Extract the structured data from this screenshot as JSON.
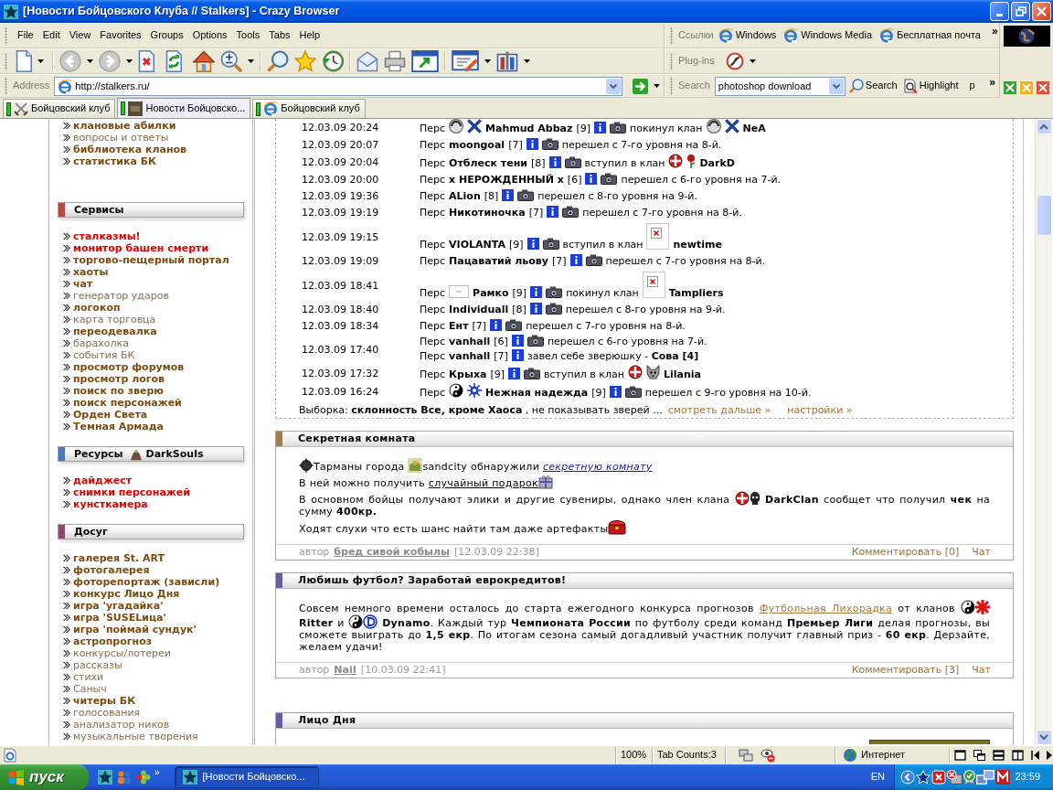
{
  "window": {
    "title": "[Новости Бойцовского Клуба // Stalkers] - Crazy Browser"
  },
  "menu": [
    "File",
    "Edit",
    "View",
    "Favorites",
    "Groups",
    "Options",
    "Tools",
    "Tabs",
    "Help"
  ],
  "links_bar": {
    "label": "Ссылки",
    "links": [
      "Windows",
      "Windows Media",
      "Бесплатная почта"
    ],
    "more": "»"
  },
  "toolbar": {
    "back": {
      "disabled": true
    },
    "forward": {
      "disabled": true
    }
  },
  "plugins_bar": {
    "label": "Plug-ins"
  },
  "address_bar": {
    "label": "Address",
    "value": "http://stalkers.ru/"
  },
  "search_bar": {
    "label": "Search",
    "value": "photoshop download",
    "buttons": [
      "Search",
      "Highlight"
    ],
    "overflow": "p",
    "more": "»"
  },
  "tabs": [
    {
      "label": "Бойцовский клуб",
      "kind": "swords",
      "selected": false
    },
    {
      "label": "Новости Бойцовско...",
      "kind": "photo",
      "selected": true
    },
    {
      "label": "Бойцовский клуб",
      "kind": "browser",
      "selected": false
    }
  ],
  "sidebar": {
    "items": [
      {
        "label": "клановые абилки",
        "kind": "bold"
      },
      {
        "label": "вопросы и ответы",
        "kind": "plain"
      },
      {
        "label": "библиотека кланов",
        "kind": "bold"
      },
      {
        "label": "статистика БК",
        "kind": "bold"
      }
    ],
    "sections": [
      {
        "title": "Сервисы",
        "color": "#b54848",
        "items": [
          {
            "label": "сталказмы!",
            "kind": "hot"
          },
          {
            "label": "монитор башен смерти",
            "kind": "hot"
          },
          {
            "label": "торгово-пещерный портал",
            "kind": "bold"
          },
          {
            "label": "хаоты",
            "kind": "bold"
          },
          {
            "label": "чат",
            "kind": "bold"
          },
          {
            "label": "генератор ударов",
            "kind": "plain"
          },
          {
            "label": "логокоп",
            "kind": "bold"
          },
          {
            "label": "карта торговца",
            "kind": "plain"
          },
          {
            "label": "переодевалка",
            "kind": "bold"
          },
          {
            "label": "барахолка",
            "kind": "plain"
          },
          {
            "label": "события БК",
            "kind": "plain"
          },
          {
            "label": "просмотр форумов",
            "kind": "bold"
          },
          {
            "label": "просмотр логов",
            "kind": "bold"
          },
          {
            "label": "поиск по зверю",
            "kind": "bold"
          },
          {
            "label": "поиск персонажей",
            "kind": "bold"
          },
          {
            "label": "Орден Света",
            "kind": "bold"
          },
          {
            "label": "Темная Армада",
            "kind": "bold"
          }
        ]
      },
      {
        "title": "Ресурсы",
        "clan": "DarkSouls",
        "color": "#4a78b8",
        "items": [
          {
            "label": "дайджест",
            "kind": "hot"
          },
          {
            "label": "снимки персонажей",
            "kind": "hot"
          },
          {
            "label": "кунсткамера",
            "kind": "hot"
          }
        ]
      },
      {
        "title": "Досуг",
        "color": "#8c4a70",
        "items": [
          {
            "label": "галерея St. ART",
            "kind": "bold"
          },
          {
            "label": "фотогалерея",
            "kind": "bold"
          },
          {
            "label": "фоторепортаж (зависли)",
            "kind": "bold"
          },
          {
            "label": "конкурс Лицо Дня",
            "kind": "bold"
          },
          {
            "label": "игра 'угадайка'",
            "kind": "bold"
          },
          {
            "label": "игра 'SUSELица'",
            "kind": "bold"
          },
          {
            "label": "игра 'поймай сундук'",
            "kind": "bold"
          },
          {
            "label": "астропрогноз",
            "kind": "bold"
          },
          {
            "label": "конкурсы/лотереи",
            "kind": "plain"
          },
          {
            "label": "рассказы",
            "kind": "plain"
          },
          {
            "label": "стихи",
            "kind": "plain"
          },
          {
            "label": "Саныч",
            "kind": "plain"
          },
          {
            "label": "читеры БК",
            "kind": "bold"
          },
          {
            "label": "голосования",
            "kind": "plain"
          },
          {
            "label": "анализатор ников",
            "kind": "plain"
          },
          {
            "label": "музыкальные творения",
            "kind": "plain"
          }
        ]
      }
    ]
  },
  "log": {
    "entries": [
      {
        "time": "12.03.09 20:24",
        "prefix": "Перс",
        "marks": [
          {
            "kind": "swirl"
          },
          {
            "kind": "xmark"
          }
        ],
        "name": "Mahmud Abbaz",
        "level": "[9]",
        "action": "покинул клан",
        "clan_marks": [
          {
            "kind": "swirl"
          },
          {
            "kind": "xmark"
          }
        ],
        "clan": "NeA"
      },
      {
        "time": "12.03.09 20:07",
        "prefix": "Перс",
        "name": "moongoal",
        "level": "[7]",
        "action": "перешел с 7-го уровня на 8-й."
      },
      {
        "time": "12.03.09 20:04",
        "prefix": "Перс",
        "name": "Отблеск тени",
        "level": "[8]",
        "action": "вступил в клан",
        "clan_marks": [
          {
            "kind": "cross"
          },
          {
            "kind": "rose"
          }
        ],
        "clan": "DarkD"
      },
      {
        "time": "12.03.09 20:00",
        "prefix": "Перс",
        "name": "х НЕРОЖДЕННЫЙ х",
        "level": "[6]",
        "action": "перешел с 6-го уровня на 7-й."
      },
      {
        "time": "12.03.09 19:36",
        "prefix": "Перс",
        "name": "ALion",
        "level": "[8]",
        "action": "перешел с 8-го уровня на 9-й."
      },
      {
        "time": "12.03.09 19:19",
        "prefix": "Перс",
        "name": "Никотиночка",
        "level": "[7]",
        "action": "перешел с 7-го уровня на 8-й."
      },
      {
        "time": "12.03.09 19:15",
        "prefix": "Перс",
        "name": "VIOLANTA",
        "level": "[9]",
        "action": "вступил в клан",
        "clan_marks": [
          {
            "kind": "broken"
          }
        ],
        "clan": "newtime"
      },
      {
        "time": "12.03.09 19:09",
        "prefix": "Перс",
        "name": "Пацаватий льову",
        "level": "[7]",
        "action": "перешел с 7-го уровня на 8-й."
      },
      {
        "time": "12.03.09 18:41",
        "prefix": "Перс",
        "marks": [
          {
            "kind": "blank"
          }
        ],
        "name": "Рамко",
        "level": "[9]",
        "action": "покинул клан",
        "clan_marks": [
          {
            "kind": "broken"
          }
        ],
        "clan": "Tampliers"
      },
      {
        "time": "12.03.09 18:40",
        "prefix": "Перс",
        "name": "Individuall",
        "level": "[8]",
        "action": "перешел с 8-го уровня на 9-й."
      },
      {
        "time": "12.03.09 18:34",
        "prefix": "Перс",
        "name": "Ент",
        "level": "[7]",
        "action": "перешел с 7-го уровня на 8-й."
      },
      {
        "time": "12.03.09 17:40",
        "prefix": "Перс",
        "name": "vanhall",
        "level": "[6]",
        "action": "перешел с 6-го уровня на 7-й.",
        "sub": {
          "prefix": "Перс",
          "name": "vanhall",
          "level": "[7]",
          "action": "завел себе зверюшку - **Сова [4]**"
        }
      },
      {
        "time": "12.03.09 17:32",
        "prefix": "Перс",
        "name": "Крыха",
        "level": "[9]",
        "action": "вступил в клан",
        "clan_marks": [
          {
            "kind": "cross"
          },
          {
            "kind": "wolf"
          }
        ],
        "clan": "Lilania"
      },
      {
        "time": "12.03.09 16:24",
        "prefix": "Перс",
        "marks": [
          {
            "kind": "yinyang"
          },
          {
            "kind": "gear"
          }
        ],
        "name": "Нежная надежда",
        "level": "[9]",
        "action": "перешел с 9-го уровня на 10-й."
      }
    ],
    "filter": "Выборка: **склонность Все, кроме Хаоса** , не показывать зверей ...",
    "links": [
      "смотреть дальше »",
      "настройки »"
    ]
  },
  "posts": [
    {
      "title": "Секретная комната",
      "color": "#a27c4c",
      "paragraphs": [
        [
          {
            "kind": "emblem"
          },
          {
            "kind": "text",
            "text": "Тарманы города "
          },
          {
            "kind": "city"
          },
          {
            "kind": "text",
            "text": "sandcity обнаружили "
          },
          {
            "kind": "link",
            "text": "секретную комнату"
          }
        ],
        [
          {
            "kind": "text",
            "text": "В ней можно получить "
          },
          {
            "kind": "underline",
            "text": "случайный подарок"
          },
          {
            "kind": "gift"
          }
        ],
        [
          {
            "kind": "text",
            "text": "В основном бойцы получают элики и другие сувениры, однако член клана "
          },
          {
            "kind": "cross"
          },
          {
            "kind": "skull"
          },
          {
            "kind": "text",
            "text": " **DarkClan** сообщет что получил **чек** на сумму **400кр.**"
          }
        ],
        [
          {
            "kind": "text",
            "text": "Ходят слухи что есть шанс найти там даже артефакты"
          },
          {
            "kind": "chest"
          }
        ]
      ],
      "footer": {
        "author_label": "автор",
        "author": "бред сивой кобылы",
        "date": "[12.03.09 22:38]",
        "comment": "Комментировать [0]",
        "chat": "Чат"
      }
    },
    {
      "title": "Любишь футбол? Заработай еврокредитов!",
      "color": "#6a5aa8",
      "paragraphs": [
        [
          {
            "kind": "text",
            "text": "Совсем немного времени осталось до старта ежегодного конкурса прогнозов "
          },
          {
            "kind": "promo",
            "text": "Футбольная Лихорадка"
          },
          {
            "kind": "text",
            "text": " от кланов "
          },
          {
            "kind": "yinyang"
          },
          {
            "kind": "asterisk"
          },
          {
            "kind": "text",
            "text": " **Ritter** и "
          },
          {
            "kind": "yinyang"
          },
          {
            "kind": "dynamo"
          },
          {
            "kind": "text",
            "text": " **Dynamo**. Каждый тур **Чемпионата России** по футболу среди команд **Премьер Лиги** делая прогнозы, вы сможете выиграть до **1,5 екр**. По итогам сезона самый догадливый участник получит главный приз - **60 екр**. Дерзайте, желаем удачи!"
          }
        ]
      ],
      "footer": {
        "author_label": "автор",
        "author": "NaiI",
        "date": "[10.03.09 22:41]",
        "comment": "Комментировать [3]",
        "chat": "Чат"
      }
    },
    {
      "title": "Лицо Дня",
      "color": "#6a5aa8"
    }
  ],
  "status_bar": {
    "zoom": "100%",
    "tab_count": "Tab Counts:3",
    "zone": "Интернет"
  },
  "taskbar": {
    "start": "пуск",
    "more": "»",
    "task": "[Новости Бойцовско...",
    "language": "EN",
    "clock": "23:59"
  }
}
